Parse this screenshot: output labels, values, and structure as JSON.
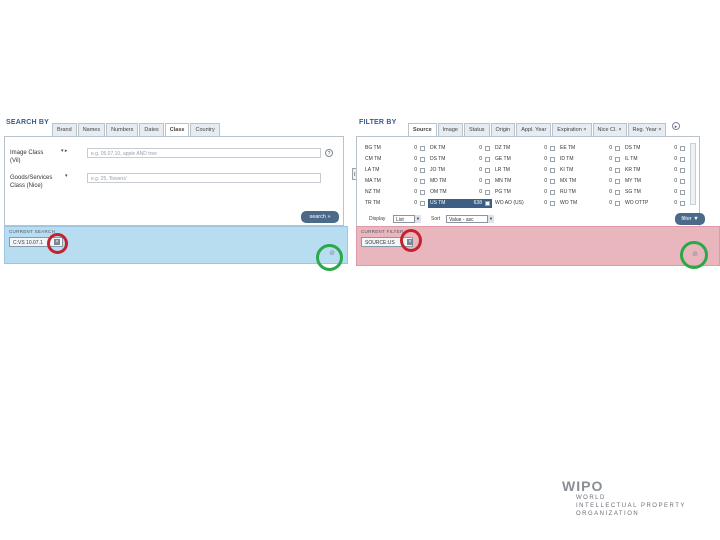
{
  "search_panel": {
    "title": "SEARCH BY",
    "tabs": [
      "Brand",
      "Names",
      "Numbers",
      "Dates",
      "Class",
      "Country"
    ],
    "active_tab": "Class",
    "fields": [
      {
        "label_line1": "Image Class",
        "label_line2": "(Vil)",
        "marker": "▾ ▸",
        "placeholder": "e.g. 05.07.10, apple AND tree"
      },
      {
        "label_line1": "Goods/Services",
        "label_line2": "Class (Nice)",
        "marker": "▾",
        "placeholder": "e.g. 25, 'flowers'"
      }
    ],
    "search_button": "search »",
    "criteria_label": "CURRENT SEARCH",
    "criteria_chip": "C:VS 10.07.1",
    "chip_remove": "×",
    "clear_icon": "⊘",
    "help_icon": "?"
  },
  "filter_panel": {
    "title": "FILTER BY",
    "tabs": [
      "Source",
      "Image",
      "Status",
      "Origin",
      "Appl. Year",
      "Expiration",
      "Nice Cl.",
      "Reg. Year"
    ],
    "active_tab": "Source",
    "tab_close": "×",
    "nav_icon": "▸",
    "sources": [
      [
        {
          "name": "BG TM",
          "count": "0"
        },
        {
          "name": "DK TM",
          "count": "0"
        },
        {
          "name": "DZ TM",
          "count": "0"
        },
        {
          "name": "EE TM",
          "count": "0"
        },
        {
          "name": "DS TM",
          "count": "0"
        }
      ],
      [
        {
          "name": "CM TM",
          "count": "0"
        },
        {
          "name": "DS TM",
          "count": "0"
        },
        {
          "name": "GE TM",
          "count": "0"
        },
        {
          "name": "ID TM",
          "count": "0"
        },
        {
          "name": "IL TM",
          "count": "0"
        }
      ],
      [
        {
          "name": "LA TM",
          "count": "0"
        },
        {
          "name": "JO TM",
          "count": "0"
        },
        {
          "name": "LR TM",
          "count": "0"
        },
        {
          "name": "KI TM",
          "count": "0"
        },
        {
          "name": "KR TM",
          "count": "0"
        }
      ],
      [
        {
          "name": "MA TM",
          "count": "0"
        },
        {
          "name": "MD TM",
          "count": "0"
        },
        {
          "name": "MN TM",
          "count": "0"
        },
        {
          "name": "MX TM",
          "count": "0"
        },
        {
          "name": "MY TM",
          "count": "0"
        }
      ],
      [
        {
          "name": "NZ TM",
          "count": "0"
        },
        {
          "name": "OM TM",
          "count": "0"
        },
        {
          "name": "PG TM",
          "count": "0"
        },
        {
          "name": "RU TM",
          "count": "0"
        },
        {
          "name": "SG TM",
          "count": "0"
        }
      ],
      [
        {
          "name": "TR TM",
          "count": "0"
        },
        {
          "name": "US TM",
          "count": "638"
        },
        {
          "name": "WO AO (US)",
          "count": "0"
        },
        {
          "name": "WO TM",
          "count": "0"
        },
        {
          "name": "WO OTTP",
          "count": "0"
        }
      ]
    ],
    "display_label": "Display",
    "display_value": "List",
    "sort_label": "Sort",
    "sort_value": "Value - asc",
    "filter_button": "filter ▼",
    "criteria_label": "CURRENT FILTER",
    "criteria_chip": "SOURCE:US",
    "chip_remove": "×",
    "clear_icon": "⊘",
    "side_tab": "II"
  },
  "logo": {
    "name": "WIPO",
    "line1": "WORLD",
    "line2": "INTELLECTUAL PROPERTY",
    "line3": "ORGANIZATION"
  },
  "colors": {
    "search_zone": "#b8dcf0",
    "filter_zone": "#eab6bd",
    "annotation_red": "#c4222e",
    "annotation_green": "#2aa84a",
    "button": "#4b6a8a"
  }
}
